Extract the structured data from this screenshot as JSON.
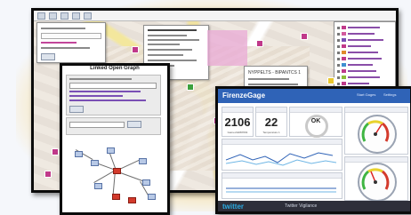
{
  "map_window": {
    "popup_title": "NYPPELTS - BIPANTCS 1",
    "pin_color": "#c0398a"
  },
  "graph_window": {
    "title": "Linked Open Graph"
  },
  "dashboard": {
    "title": "FirenzeGage",
    "header_color": "#2f63b7",
    "menu_items": [
      "Start Gages",
      "Settings"
    ],
    "widgets": [
      {
        "value": "2106",
        "label": "Gamed ERRISSI"
      },
      {
        "value": "22",
        "label": "Temperature 1"
      },
      {
        "value": "OK",
        "label": "Status"
      }
    ],
    "footer": {
      "brand": "twitter",
      "text": "Twitter Vigilance"
    },
    "gauge_colors": {
      "green": "#3fb542",
      "yellow": "#e8d22d",
      "red": "#d33a2c"
    }
  }
}
